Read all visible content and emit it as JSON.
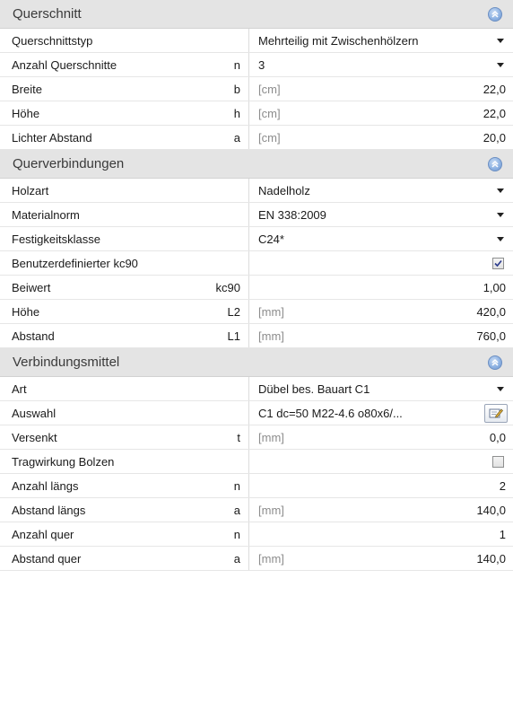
{
  "sections": [
    {
      "title": "Querschnitt",
      "rows": [
        {
          "label": "Querschnittstyp",
          "symbol": "",
          "unit": "",
          "value": "Mehrteilig mit Zwischenhölzern",
          "control": "dropdown"
        },
        {
          "label": "Anzahl Querschnitte",
          "symbol": "n",
          "unit": "",
          "value": "3",
          "control": "dropdown"
        },
        {
          "label": "Breite",
          "symbol": "b",
          "unit": "[cm]",
          "value": "22,0",
          "control": "number"
        },
        {
          "label": "Höhe",
          "symbol": "h",
          "unit": "[cm]",
          "value": "22,0",
          "control": "number"
        },
        {
          "label": "Lichter Abstand",
          "symbol": "a",
          "unit": "[cm]",
          "value": "20,0",
          "control": "number"
        }
      ]
    },
    {
      "title": "Querverbindungen",
      "rows": [
        {
          "label": "Holzart",
          "symbol": "",
          "unit": "",
          "value": "Nadelholz",
          "control": "dropdown"
        },
        {
          "label": "Materialnorm",
          "symbol": "",
          "unit": "",
          "value": "EN 338:2009",
          "control": "dropdown"
        },
        {
          "label": "Festigkeitsklasse",
          "symbol": "",
          "unit": "",
          "value": "C24*",
          "control": "dropdown"
        },
        {
          "label": "Benutzerdefinierter kc90",
          "symbol": "",
          "unit": "",
          "value": "",
          "control": "checkbox",
          "checked": true
        },
        {
          "label": "Beiwert",
          "symbol": "kc90",
          "unit": "",
          "value": "1,00",
          "control": "number"
        },
        {
          "label": "Höhe",
          "symbol": "L2",
          "unit": "[mm]",
          "value": "420,0",
          "control": "number"
        },
        {
          "label": "Abstand",
          "symbol": "L1",
          "unit": "[mm]",
          "value": "760,0",
          "control": "number"
        }
      ]
    },
    {
      "title": "Verbindungsmittel",
      "rows": [
        {
          "label": "Art",
          "symbol": "",
          "unit": "",
          "value": "Dübel bes. Bauart C1",
          "control": "dropdown"
        },
        {
          "label": "Auswahl",
          "symbol": "",
          "unit": "",
          "value": "C1 dc=50 M22-4.6 o80x6/...",
          "control": "edit"
        },
        {
          "label": "Versenkt",
          "symbol": "t",
          "unit": "[mm]",
          "value": "0,0",
          "control": "number"
        },
        {
          "label": "Tragwirkung Bolzen",
          "symbol": "",
          "unit": "",
          "value": "",
          "control": "checkbox",
          "checked": false
        },
        {
          "label": "Anzahl längs",
          "symbol": "n",
          "unit": "",
          "value": "2",
          "control": "number"
        },
        {
          "label": "Abstand längs",
          "symbol": "a",
          "unit": "[mm]",
          "value": "140,0",
          "control": "number"
        },
        {
          "label": "Anzahl quer",
          "symbol": "n",
          "unit": "",
          "value": "1",
          "control": "number"
        },
        {
          "label": "Abstand quer",
          "symbol": "a",
          "unit": "[mm]",
          "value": "140,0",
          "control": "number"
        }
      ]
    }
  ],
  "icons": {
    "collapse": "chevron-up-double-icon",
    "checkbox_checked": "check-icon",
    "edit": "edit-icon"
  },
  "colors": {
    "header_bg": "#e4e4e4",
    "collapse_btn": "#8fb3e3",
    "unit_text": "#8c8c8c"
  }
}
